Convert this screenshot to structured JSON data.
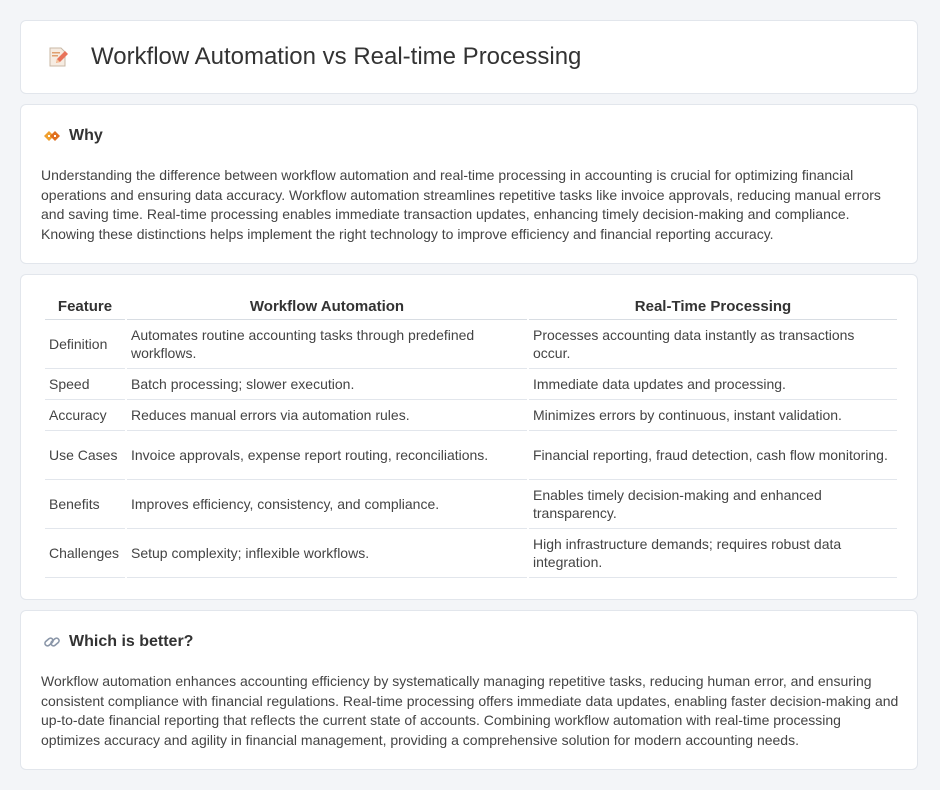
{
  "title": "Workflow Automation vs Real-time Processing",
  "icons": {
    "title": "pencil-document-icon",
    "why": "diamond-signs-icon",
    "better": "link-icon"
  },
  "why": {
    "heading": "Why",
    "text": "Understanding the difference between workflow automation and real-time processing in accounting is crucial for optimizing financial operations and ensuring data accuracy. Workflow automation streamlines repetitive tasks like invoice approvals, reducing manual errors and saving time. Real-time processing enables immediate transaction updates, enhancing timely decision-making and compliance. Knowing these distinctions helps implement the right technology to improve efficiency and financial reporting accuracy."
  },
  "table": {
    "headers": [
      "Feature",
      "Workflow Automation",
      "Real-Time Processing"
    ],
    "rows": [
      [
        "Definition",
        "Automates routine accounting tasks through predefined workflows.",
        "Processes accounting data instantly as transactions occur."
      ],
      [
        "Speed",
        "Batch processing; slower execution.",
        "Immediate data updates and processing."
      ],
      [
        "Accuracy",
        "Reduces manual errors via automation rules.",
        "Minimizes errors by continuous, instant validation."
      ],
      [
        "Use Cases",
        "Invoice approvals, expense report routing, reconciliations.",
        "Financial reporting, fraud detection, cash flow monitoring."
      ],
      [
        "Benefits",
        "Improves efficiency, consistency, and compliance.",
        "Enables timely decision-making and enhanced transparency."
      ],
      [
        "Challenges",
        "Setup complexity; inflexible workflows.",
        "High infrastructure demands; requires robust data integration."
      ]
    ]
  },
  "better": {
    "heading": "Which is better?",
    "text": "Workflow automation enhances accounting efficiency by systematically managing repetitive tasks, reducing human error, and ensuring consistent compliance with financial regulations. Real-time processing offers immediate data updates, enabling faster decision-making and up-to-date financial reporting that reflects the current state of accounts. Combining workflow automation with real-time processing optimizes accuracy and agility in financial management, providing a comprehensive solution for modern accounting needs."
  }
}
